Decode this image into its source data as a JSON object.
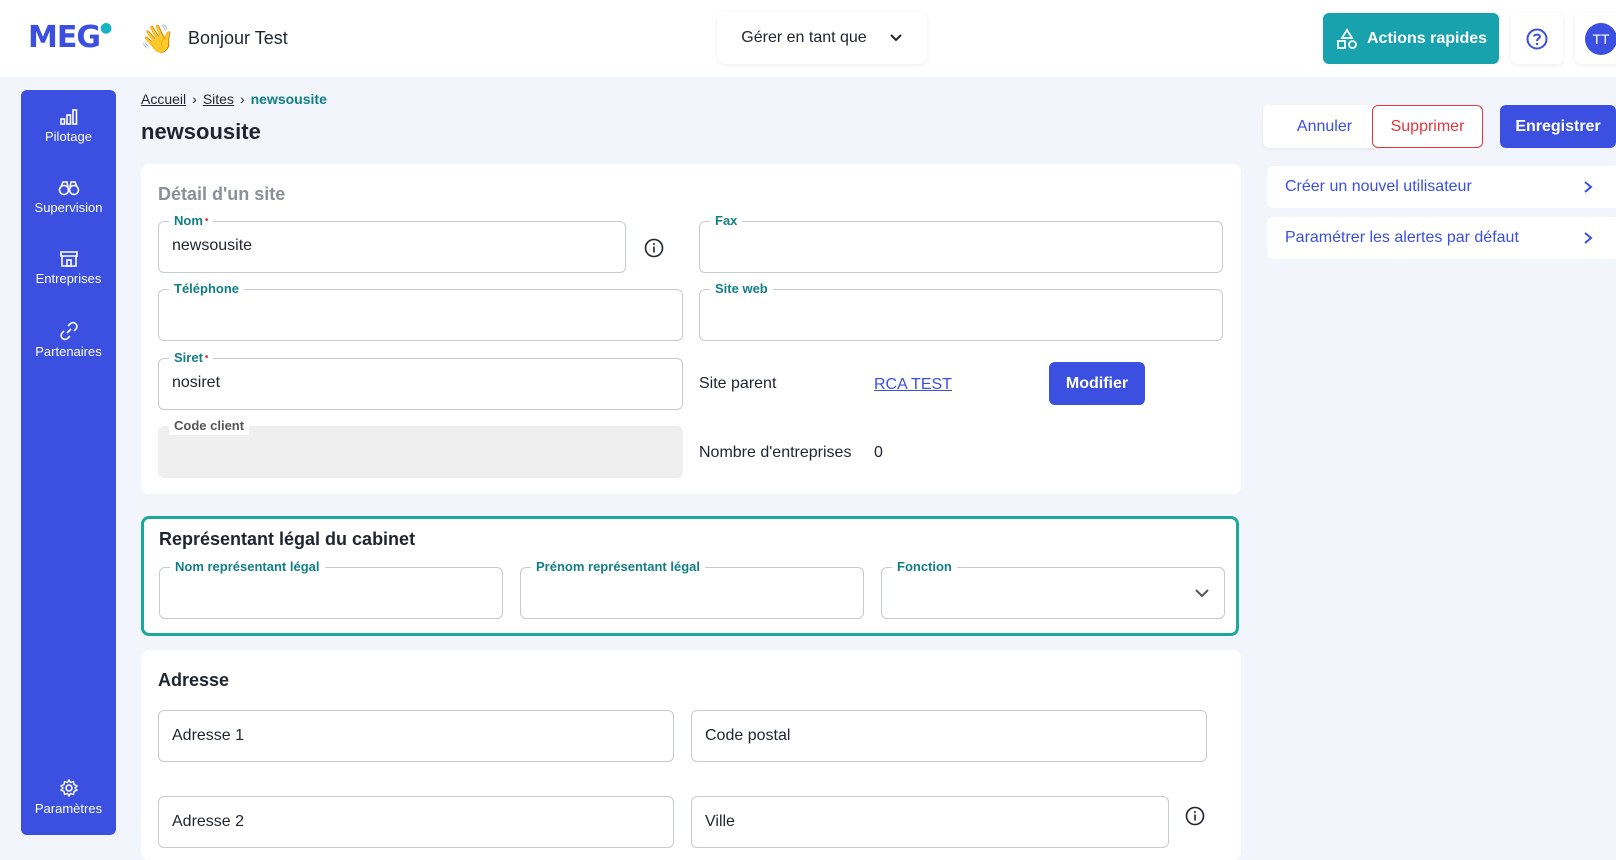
{
  "header": {
    "logo_text": "MEG",
    "greeting": "Bonjour Test",
    "manage_label": "Gérer en tant que",
    "quick_actions_label": "Actions rapides",
    "avatar_initials": "TT"
  },
  "sidebar": {
    "items": [
      {
        "label": "Pilotage",
        "icon": "chart-icon"
      },
      {
        "label": "Supervision",
        "icon": "binoculars-icon"
      },
      {
        "label": "Entreprises",
        "icon": "store-icon"
      },
      {
        "label": "Partenaires",
        "icon": "link-icon"
      }
    ],
    "settings_label": "Paramètres"
  },
  "breadcrumb": {
    "home": "Accueil",
    "sites": "Sites",
    "current": "newsousite"
  },
  "page_title": "newsousite",
  "actions": {
    "cancel": "Annuler",
    "delete": "Supprimer",
    "save": "Enregistrer"
  },
  "side_links": [
    {
      "label": "Créer un nouvel utilisateur"
    },
    {
      "label": "Paramétrer les alertes par défaut"
    }
  ],
  "detail": {
    "title": "Détail d'un site",
    "nom_label": "Nom",
    "nom_value": "newsousite",
    "fax_label": "Fax",
    "fax_value": "",
    "telephone_label": "Téléphone",
    "telephone_value": "",
    "siteweb_label": "Site web",
    "siteweb_value": "",
    "siret_label": "Siret",
    "siret_value": "nosiret",
    "codeclient_label": "Code client",
    "codeclient_value": "",
    "site_parent_label": "Site parent",
    "site_parent_value": "RCA TEST",
    "modify_label": "Modifier",
    "nb_entreprises_label": "Nombre d'entreprises",
    "nb_entreprises_value": "0"
  },
  "legal": {
    "title": "Représentant légal du cabinet",
    "nom_label": "Nom représentant légal",
    "prenom_label": "Prénom représentant légal",
    "fonction_label": "Fonction"
  },
  "address": {
    "title": "Adresse",
    "adresse1_placeholder": "Adresse 1",
    "codepostal_placeholder": "Code postal",
    "adresse2_placeholder": "Adresse 2",
    "ville_placeholder": "Ville"
  },
  "colors": {
    "primary": "#3b4fe0",
    "teal": "#18a2ad",
    "danger": "#e0383e",
    "highlight_border": "#1aa89a"
  }
}
